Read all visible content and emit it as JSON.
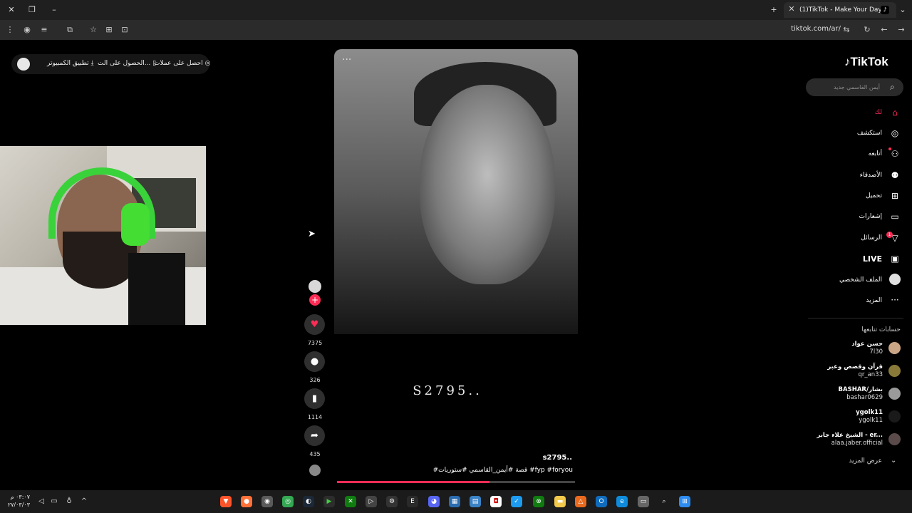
{
  "browser": {
    "tab_title": "(1)TikTok - Make Your Day",
    "url": "tiktok.com/ar/",
    "tab_favicon_glyph": "♪"
  },
  "topbar": {
    "coins": "احصل على عملات",
    "get_app": "الحصول على الت...",
    "desktop_app": "تطبيق الكمبيوتر"
  },
  "sidebar": {
    "logo": "TikTok",
    "search_placeholder": "أيمن القاسمي جديد",
    "nav": [
      {
        "label": "لك",
        "icon": "home-icon",
        "active": true
      },
      {
        "label": "استكشف",
        "icon": "explore-icon"
      },
      {
        "label": "أتابعه",
        "icon": "following-icon"
      },
      {
        "label": "الأصدقاء",
        "icon": "friends-icon"
      },
      {
        "label": "تحميل",
        "icon": "upload-icon"
      },
      {
        "label": "إشعارات",
        "icon": "notifications-icon"
      },
      {
        "label": "الرسائل",
        "icon": "messages-icon"
      },
      {
        "label": "LIVE",
        "icon": "live-icon"
      },
      {
        "label": "الملف الشخصي",
        "icon": "profile-icon"
      },
      {
        "label": "المزيد",
        "icon": "more-icon"
      }
    ],
    "messages_badge": "1",
    "following_heading": "حسابات تتابعها",
    "following": [
      {
        "name": "حسن عواد",
        "handle": "7l30"
      },
      {
        "name": "قرآن وقصص وعبر",
        "handle": "qr_an33"
      },
      {
        "name": "BASHAR/بشار",
        "handle": "bashar0629"
      },
      {
        "name": "ygolk11",
        "handle": "ygolk11"
      },
      {
        "name": "الشيخ علاء جابر - er...",
        "handle": "alaa.jaber.official"
      }
    ],
    "see_more": "عرض المزيد"
  },
  "video": {
    "overlay_text": "S2795..",
    "author": "s2795..",
    "tags": "#قصة #أيمن_القاسمي #ستوريات #fyp #foryou",
    "progress": 0.64
  },
  "actions": {
    "likes": "7375",
    "comments": "326",
    "saves": "1114",
    "shares": "435"
  },
  "taskbar": {
    "time": "٠٣:٠٧ م",
    "date": "٢٧/٠٣/٠٣"
  },
  "colors": {
    "accent": "#fe2c55",
    "bg": "#000000",
    "chrome": "#1f1f1f"
  }
}
